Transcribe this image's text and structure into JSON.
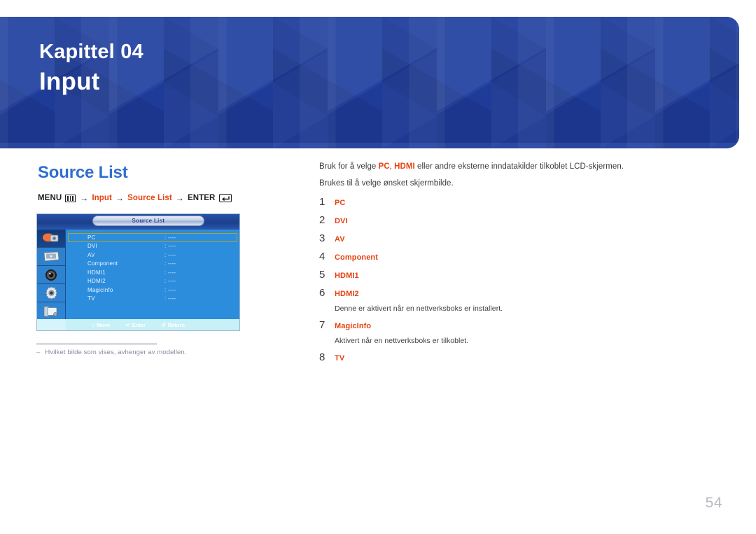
{
  "banner": {
    "kicker": "Kapittel 04",
    "title": "Input",
    "bg_color": "#1f3e9e"
  },
  "section": {
    "heading": "Source List",
    "heading_color": "#2f6fd0"
  },
  "menu_path": {
    "menu_label": "MENU",
    "menu_icon": "menu-grid-icon",
    "arrow": "→",
    "step1": "Input",
    "step2": "Source List",
    "enter_label": "ENTER",
    "enter_icon": "enter-return-icon",
    "accent_color": "#e8420f"
  },
  "osd": {
    "title": "Source List",
    "sidebar_icons": [
      "input-source-icon",
      "picture-icon",
      "sound-icon",
      "setup-gear-icon",
      "multi-control-icon"
    ],
    "rows": [
      {
        "label": "PC",
        "value": ": ----",
        "selected": true
      },
      {
        "label": "DVI",
        "value": ": ----",
        "selected": false
      },
      {
        "label": "AV",
        "value": ": ----",
        "selected": false
      },
      {
        "label": "Component",
        "value": ": ----",
        "selected": false
      },
      {
        "label": "HDMI1",
        "value": ": ----",
        "selected": false
      },
      {
        "label": "HDMI2",
        "value": ": ----",
        "selected": false
      },
      {
        "label": "MagicInfo",
        "value": ": ----",
        "selected": false
      },
      {
        "label": "TV",
        "value": ": ----",
        "selected": false
      }
    ],
    "hints": [
      {
        "glyph": "↕",
        "label": "Move"
      },
      {
        "glyph": "↵",
        "label": "Enter"
      },
      {
        "glyph": "↺",
        "label": "Return"
      }
    ],
    "highlight_color": "#b3a32a"
  },
  "footnote": {
    "dash": "–",
    "text": "Hvilket bilde som vises, avhenger av modellen."
  },
  "content": {
    "intro_1_a": "Bruk for å velge ",
    "intro_1_pc": "PC",
    "intro_1_b": ", ",
    "intro_1_hdmi": "HDMI",
    "intro_1_c": " eller andre eksterne inndatakilder tilkoblet LCD-skjermen.",
    "intro_2": "Brukes til å velge ønsket skjermbilde.",
    "items": [
      {
        "num": "1",
        "term": "PC",
        "note": null
      },
      {
        "num": "2",
        "term": "DVI",
        "note": null
      },
      {
        "num": "3",
        "term": "AV",
        "note": null
      },
      {
        "num": "4",
        "term": "Component",
        "note": null
      },
      {
        "num": "5",
        "term": "HDMI1",
        "note": null
      },
      {
        "num": "6",
        "term": "HDMI2",
        "note": "Denne er aktivert når en nettverksboks er installert."
      },
      {
        "num": "7",
        "term": "MagicInfo",
        "note": "Aktivert når en nettverksboks er tilkoblet."
      },
      {
        "num": "8",
        "term": "TV",
        "note": null
      }
    ]
  },
  "page": {
    "number": "54"
  }
}
